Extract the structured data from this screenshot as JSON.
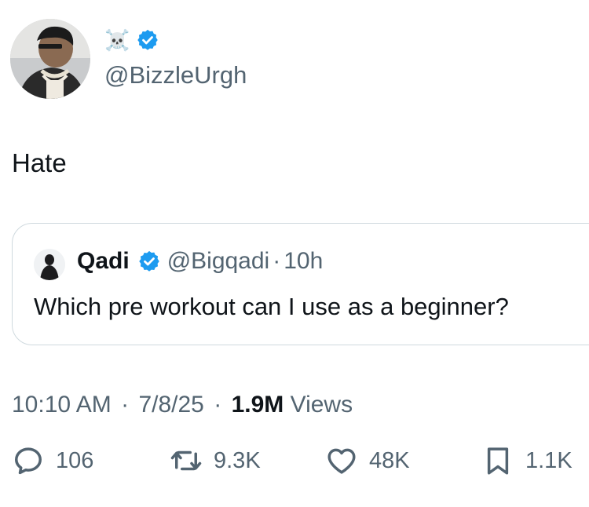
{
  "author": {
    "display_name": "☠️",
    "handle": "@BizzleUrgh",
    "verified": true
  },
  "tweet": {
    "text": "Hate"
  },
  "quoted": {
    "name": "Qadi",
    "handle": "@Bigqadi",
    "separator": "·",
    "age": "10h",
    "verified": true,
    "text": "Which pre workout can I use as a beginner?"
  },
  "meta": {
    "time": "10:10 AM",
    "date": "7/8/25",
    "separator": "·",
    "views_count": "1.9M",
    "views_label": "Views"
  },
  "actions": {
    "replies": "106",
    "reposts": "9.3K",
    "likes": "48K",
    "bookmarks": "1.1K"
  },
  "colors": {
    "verified_blue": "#1d9bf0",
    "secondary_text": "#536471",
    "primary_text": "#0f1419",
    "border": "#cfd9de"
  }
}
